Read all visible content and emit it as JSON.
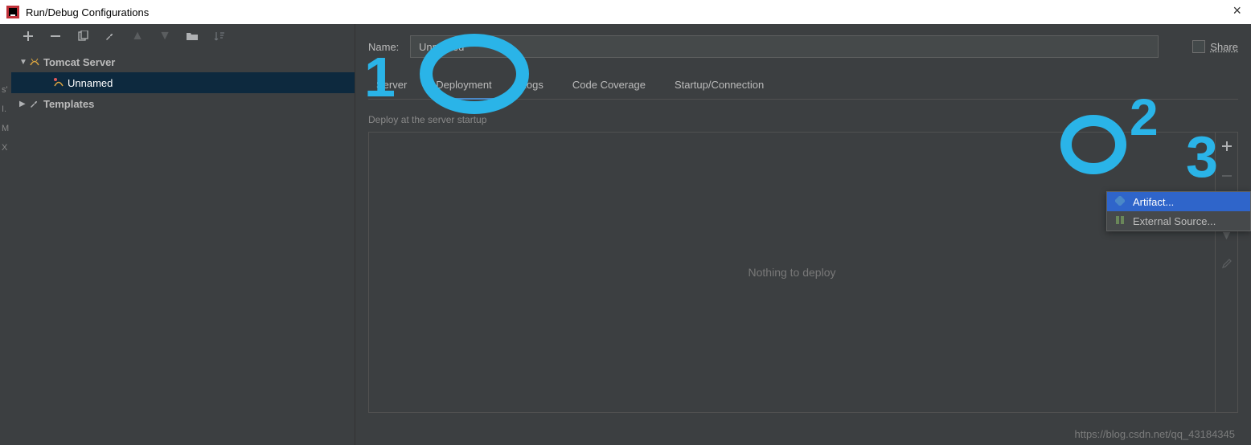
{
  "window": {
    "title": "Run/Debug Configurations"
  },
  "sidebar": {
    "items": [
      {
        "label": "Tomcat Server",
        "expanded": true
      },
      {
        "label": "Unnamed",
        "selected": true
      },
      {
        "label": "Templates",
        "expanded": false
      }
    ]
  },
  "form": {
    "name_label": "Name:",
    "name_value": "Unnamed",
    "share_label": "Share"
  },
  "tabs": [
    {
      "label": "Server",
      "active": false
    },
    {
      "label": "Deployment",
      "active": true
    },
    {
      "label": "Logs",
      "active": false
    },
    {
      "label": "Code Coverage",
      "active": false
    },
    {
      "label": "Startup/Connection",
      "active": false
    }
  ],
  "deployment": {
    "section_label": "Deploy at the server startup",
    "empty_text": "Nothing to deploy"
  },
  "popup": {
    "items": [
      {
        "label": "Artifact...",
        "selected": true
      },
      {
        "label": "External Source...",
        "selected": false
      }
    ]
  },
  "watermark": "https://blog.csdn.net/qq_43184345",
  "annotations": {
    "one": "1",
    "two": "2",
    "three": "3"
  }
}
